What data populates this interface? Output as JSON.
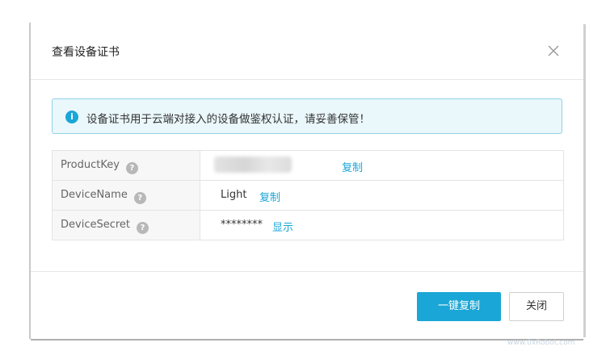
{
  "dialog": {
    "title": "查看设备证书",
    "close_icon": "close-icon"
  },
  "alert": {
    "icon": "info-icon",
    "text": "设备证书用于云端对接入的设备做鉴权认证，请妥善保管！",
    "color": "#1aa6d6"
  },
  "fields": [
    {
      "key": "ProductKey",
      "value": "",
      "value_masked_blur": true,
      "action": "复制"
    },
    {
      "key": "DeviceName",
      "value": "Light",
      "action": "复制"
    },
    {
      "key": "DeviceSecret",
      "value": "********",
      "action": "显示"
    }
  ],
  "footer": {
    "copy_all_label": "一键复制",
    "close_label": "关闭"
  },
  "watermark": "www.0xRobot.com",
  "colors": {
    "accent": "#1aa6d6",
    "alert_bg": "#eaf7fb"
  }
}
